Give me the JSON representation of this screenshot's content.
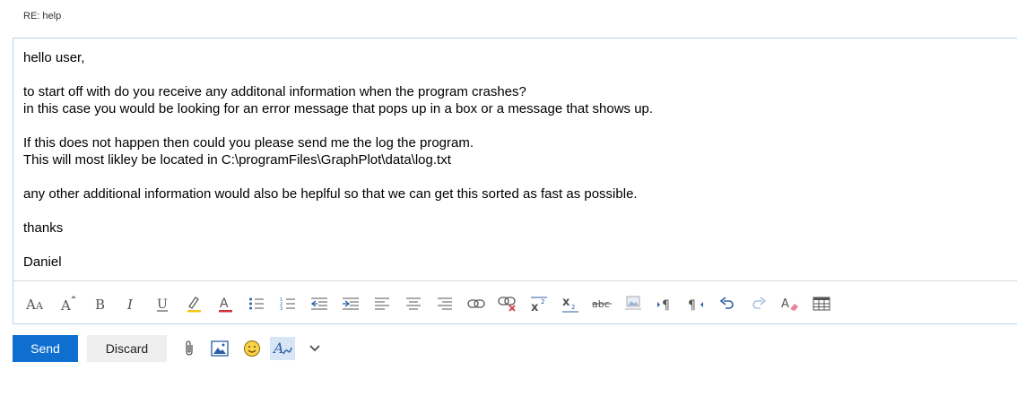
{
  "subject": "RE: help",
  "body_lines": [
    "hello user,",
    "",
    "to start off with do you receive any additonal information when the program crashes?",
    "in this case you would be looking for an error message that pops up in a box or a message that shows up.",
    "",
    "If this does not happen then could you please send me the log the program.",
    "This will most likley be located in C:\\programFiles\\GraphPlot\\data\\log.txt",
    "",
    "any other additional information would also be heplful so that we can get this sorted as fast as possible.",
    "",
    "thanks",
    "",
    "Daniel"
  ],
  "toolbar": {
    "send_label": "Send",
    "discard_label": "Discard"
  },
  "format_icons": [
    "font-size-icon",
    "grow-font-icon",
    "bold-icon",
    "italic-icon",
    "underline-icon",
    "highlight-icon",
    "font-color-icon",
    "bullets-icon",
    "numbering-icon",
    "decrease-indent-icon",
    "increase-indent-icon",
    "align-left-icon",
    "align-center-icon",
    "align-right-icon",
    "insert-link-icon",
    "remove-link-icon",
    "superscript-icon",
    "subscript-icon",
    "strikethrough-icon",
    "insert-image-inline-icon",
    "ltr-icon",
    "rtl-icon",
    "undo-icon",
    "redo-icon",
    "clear-formatting-icon",
    "insert-table-icon"
  ],
  "bottom_icons": [
    "attach-icon",
    "insert-picture-icon",
    "emoji-icon",
    "formatting-toggle-icon",
    "more-options-icon"
  ],
  "colors": {
    "accent": "#0f6fd0",
    "border": "#b9d3ec",
    "active_bg": "#d7e5f6",
    "font_color_bar": "#d13438",
    "highlight_bar": "#f5c518"
  }
}
